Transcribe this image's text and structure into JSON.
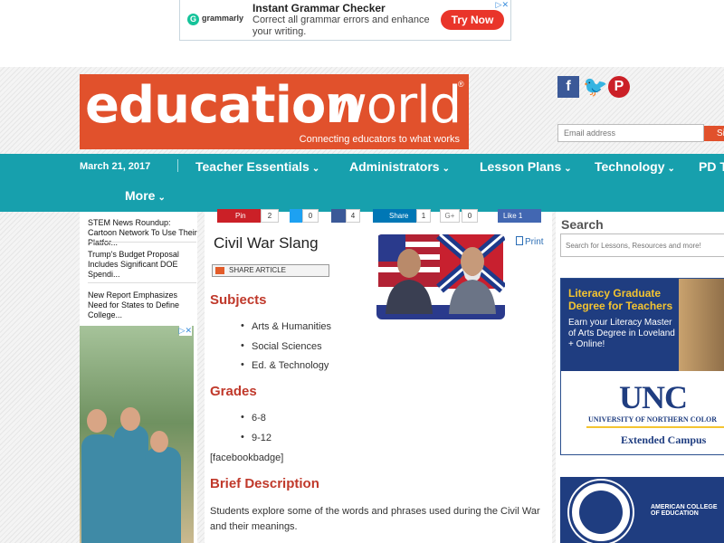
{
  "ad": {
    "brand": "grammarly",
    "title": "Instant Grammar Checker",
    "body": "Correct all grammar errors and enhance your writing.",
    "cta": "Try Now"
  },
  "logo": {
    "word1": "education",
    "word2": "world",
    "reg": "®",
    "tagline": "Connecting educators to what works"
  },
  "header": {
    "email_placeholder": "Email address",
    "email_btn": "Si"
  },
  "nav": {
    "date": "March 21, 2017",
    "items": [
      "Teacher Essentials",
      "Administrators",
      "Lesson Plans",
      "Technology",
      "PD T",
      "More"
    ]
  },
  "news": [
    "STEM News Roundup: Cartoon Network To Use Their Platfor...",
    "Trump's Budget Proposal Includes Significant DOE Spendi...",
    "New Report Emphasizes Need for States to Define College..."
  ],
  "share": {
    "pin": "Pin",
    "pin_count": "2",
    "tw_count": "0",
    "fb_count": "4",
    "in_label": "Share",
    "in_count": "1",
    "gp_label": "G+",
    "gp_count": "0",
    "like_label": "Like 1"
  },
  "article": {
    "title": "Civil War Slang",
    "share_article": "SHARE ARTICLE",
    "print": "Print",
    "subjects_h": "Subjects",
    "subjects": [
      "Arts & Humanities",
      "Social Sciences",
      "Ed. & Technology"
    ],
    "grades_h": "Grades",
    "grades": [
      "6-8",
      "9-12"
    ],
    "badge": "[facebookbadge]",
    "brief_h": "Brief Description",
    "brief": "Students explore some of the words and phrases used during the Civil War and their meanings."
  },
  "sidebar": {
    "search_h": "Search",
    "search_placeholder": "Search for Lessons, Resources and more!",
    "unc_l1": "Literacy Graduate Degree for Teachers",
    "unc_l2": "Earn your Literacy Master of Arts Degree in Loveland + Online!",
    "unc_name": "UNC",
    "unc_sub": "UNIVERSITY OF NORTHERN COLOR",
    "unc_ext": "Extended Campus",
    "ace_text": "AMERICAN COLLEGE OF EDUCATION"
  }
}
